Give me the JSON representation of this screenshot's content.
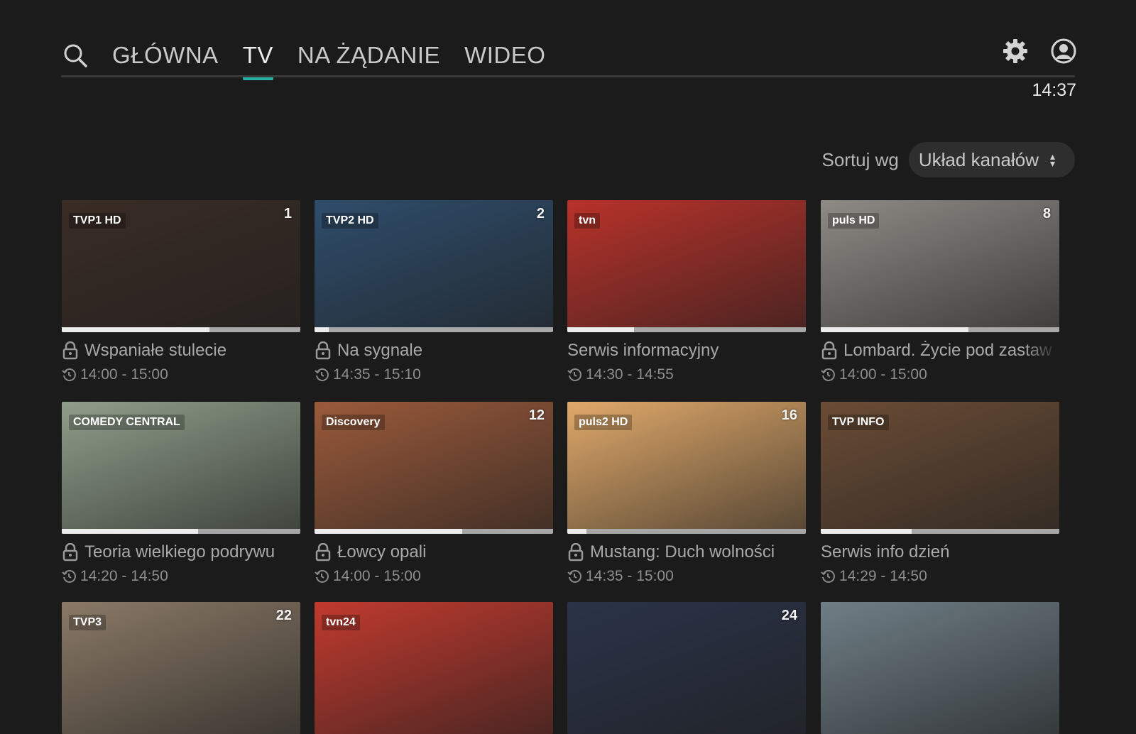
{
  "nav": {
    "tabs": [
      {
        "label": "GŁÓWNA",
        "active": false
      },
      {
        "label": "TV",
        "active": true
      },
      {
        "label": "NA ŻĄDANIE",
        "active": false
      },
      {
        "label": "WIDEO",
        "active": false
      }
    ],
    "accent": "#27b1a5"
  },
  "clock": "14:37",
  "sort": {
    "label": "Sortuj wg",
    "value": "Układ kanałów"
  },
  "channels": [
    {
      "num": "1",
      "logo": "TVP1 HD",
      "title": "Wspaniałe stulecie",
      "time": "14:00 - 15:00",
      "locked": true,
      "progress": 0.62,
      "bg": "#3a2c25"
    },
    {
      "num": "2",
      "logo": "TVP2 HD",
      "title": "Na sygnale",
      "time": "14:35 - 15:10",
      "locked": true,
      "progress": 0.06,
      "bg": "#2f4d6b"
    },
    {
      "num": "",
      "logo": "tvn",
      "title": "Serwis informacyjny",
      "time": "14:30 - 14:55",
      "locked": false,
      "progress": 0.28,
      "bg": "#b8322a"
    },
    {
      "num": "8",
      "logo": "puls HD",
      "title": "Lombard. Życie pod zastaw",
      "time": "14:00 - 15:00",
      "locked": true,
      "progress": 0.62,
      "bg": "#8e8a86"
    },
    {
      "num": "",
      "logo": "COMEDY CENTRAL",
      "title": "Teoria wielkiego podrywu",
      "time": "14:20 - 14:50",
      "locked": true,
      "progress": 0.57,
      "bg": "#8f9e8a"
    },
    {
      "num": "12",
      "logo": "Discovery",
      "title": "Łowcy opali",
      "time": "14:00 - 15:00",
      "locked": true,
      "progress": 0.62,
      "bg": "#9a5a3a"
    },
    {
      "num": "16",
      "logo": "puls2 HD",
      "title": "Mustang: Duch wolności",
      "time": "14:35 - 15:00",
      "locked": true,
      "progress": 0.08,
      "bg": "#e0a96a"
    },
    {
      "num": "",
      "logo": "TVP INFO",
      "title": "Serwis info dzień",
      "time": "14:29 - 14:50",
      "locked": false,
      "progress": 0.38,
      "bg": "#6a4c35"
    },
    {
      "num": "22",
      "logo": "TVP3",
      "title": "",
      "time": "",
      "locked": false,
      "progress": 0,
      "bg": "#8a7966"
    },
    {
      "num": "",
      "logo": "tvn24",
      "title": "",
      "time": "",
      "locked": false,
      "progress": 0,
      "bg": "#c03a2e"
    },
    {
      "num": "24",
      "logo": "",
      "title": "",
      "time": "",
      "locked": false,
      "progress": 0,
      "bg": "#2a3348"
    },
    {
      "num": "",
      "logo": "",
      "title": "",
      "time": "",
      "locked": false,
      "progress": 0,
      "bg": "#6f7e86"
    }
  ]
}
